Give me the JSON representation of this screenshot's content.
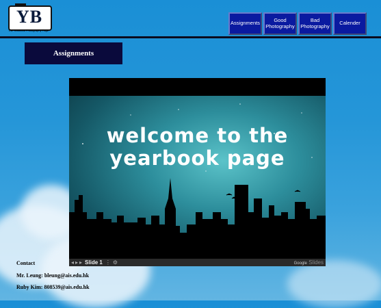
{
  "logo": {
    "letters": "YB",
    "tagline": "The Yearbook Photography Page"
  },
  "nav": [
    {
      "label": "Assignments"
    },
    {
      "label": "Good Photography"
    },
    {
      "label": "Bad Photography"
    },
    {
      "label": "Calender"
    }
  ],
  "section_title": "Assignments",
  "slideshow": {
    "title_line1": "welcome to the",
    "title_line2": "yearbook page",
    "slide_label": "Slide 1",
    "brand": "Google",
    "brand_product": "Slides"
  },
  "contact": {
    "heading": "Contact",
    "line1": "Mr. Leung: bleung@ais.edu.hk",
    "line2": "Ruby Kim: 808539@ais.edu.hk"
  }
}
